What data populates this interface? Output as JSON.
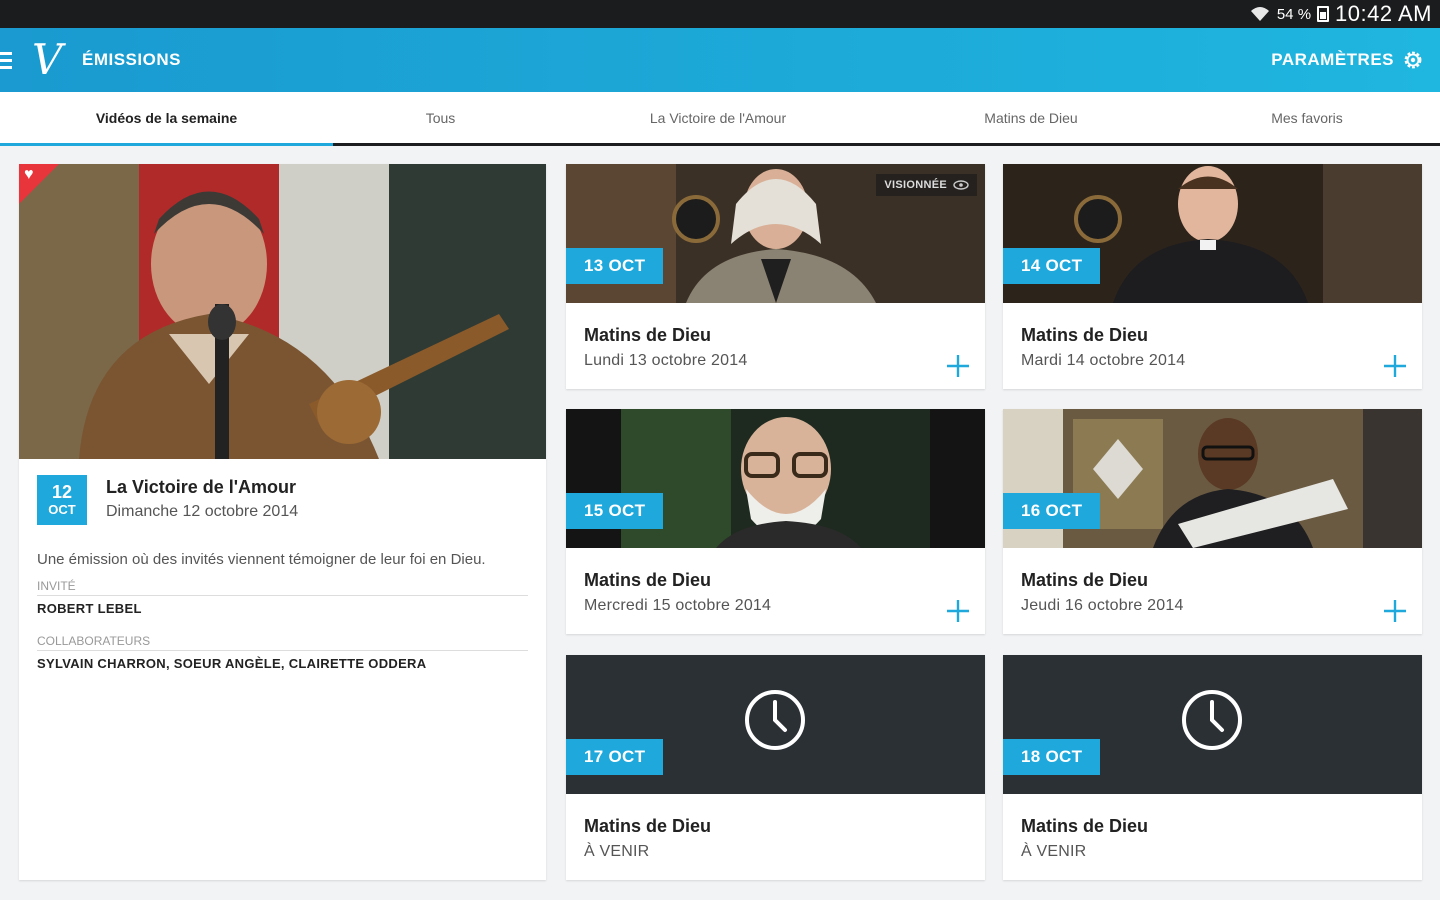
{
  "status_bar": {
    "battery": "54 %",
    "time": "10:42 AM"
  },
  "app_bar": {
    "logo": "V",
    "title": "ÉMISSIONS",
    "settings_label": "PARAMÈTRES"
  },
  "tabs": [
    {
      "label": "Vidéos de la semaine",
      "active": true
    },
    {
      "label": "Tous",
      "active": false
    },
    {
      "label": "La Victoire de l'Amour",
      "active": false
    },
    {
      "label": "Matins de Dieu",
      "active": false
    },
    {
      "label": "Mes favoris",
      "active": false
    }
  ],
  "featured": {
    "day": "12",
    "month": "OCT",
    "title": "La Victoire de l'Amour",
    "date": "Dimanche 12 octobre 2014",
    "description": "Une émission où des invités viennent témoigner de leur foi en Dieu.",
    "guest_label": "INVITÉ",
    "guest": "ROBERT LEBEL",
    "collaborators_label": "COLLABORATEURS",
    "collaborators": "SYLVAIN CHARRON, SOEUR ANGÈLE, CLAIRETTE ODDERA"
  },
  "episodes": [
    {
      "date": "13 OCT",
      "title": "Matins de Dieu",
      "subtitle": "Lundi 13 octobre 2014",
      "watched": "VISIONNÉE"
    },
    {
      "date": "14 OCT",
      "title": "Matins de Dieu",
      "subtitle": "Mardi 14 octobre 2014"
    },
    {
      "date": "15 OCT",
      "title": "Matins de Dieu",
      "subtitle": "Mercredi 15 octobre 2014"
    },
    {
      "date": "16 OCT",
      "title": "Matins de Dieu",
      "subtitle": "Jeudi 16 octobre 2014"
    },
    {
      "date": "17 OCT",
      "title": "Matins de Dieu",
      "subtitle": "À VENIR"
    },
    {
      "date": "18 OCT",
      "title": "Matins de Dieu",
      "subtitle": "À VENIR"
    }
  ],
  "colors": {
    "accent": "#1fa8db",
    "favorite": "#e8353b",
    "upcoming_bg": "#2b3035"
  }
}
